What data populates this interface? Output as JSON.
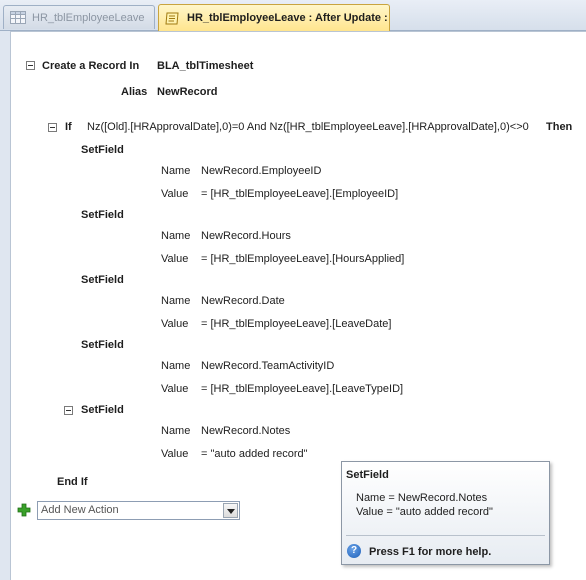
{
  "tabs": [
    {
      "label": "HR_tblEmployeeLeave",
      "active": false,
      "icon": "table-icon"
    },
    {
      "label": "HR_tblEmployeeLeave : After Update :",
      "active": true,
      "icon": "macro-icon"
    }
  ],
  "macro": {
    "create_record": {
      "keyword": "Create a Record In",
      "target": "BLA_tblTimesheet",
      "alias_label": "Alias",
      "alias_value": "NewRecord"
    },
    "if_block": {
      "keyword": "If",
      "condition": "Nz([Old].[HRApprovalDate],0)=0 And Nz([HR_tblEmployeeLeave].[HRApprovalDate],0)<>0",
      "then_keyword": "Then",
      "end_keyword": "End If"
    },
    "setfields": [
      {
        "label": "SetField",
        "name_label": "Name",
        "name": "NewRecord.EmployeeID",
        "value_label": "Value",
        "value": "= [HR_tblEmployeeLeave].[EmployeeID]"
      },
      {
        "label": "SetField",
        "name_label": "Name",
        "name": "NewRecord.Hours",
        "value_label": "Value",
        "value": "= [HR_tblEmployeeLeave].[HoursApplied]"
      },
      {
        "label": "SetField",
        "name_label": "Name",
        "name": "NewRecord.Date",
        "value_label": "Value",
        "value": "= [HR_tblEmployeeLeave].[LeaveDate]"
      },
      {
        "label": "SetField",
        "name_label": "Name",
        "name": "NewRecord.TeamActivityID",
        "value_label": "Value",
        "value": "= [HR_tblEmployeeLeave].[LeaveTypeID]"
      },
      {
        "label": "SetField",
        "name_label": "Name",
        "name": "NewRecord.Notes",
        "value_label": "Value",
        "value": "= \"auto added record\""
      }
    ]
  },
  "add_action": {
    "placeholder": "Add New Action"
  },
  "tooltip": {
    "title": "SetField",
    "line1": "Name = NewRecord.Notes",
    "line2": "Value = \"auto added record\"",
    "help_text": "Press F1 for more help."
  },
  "colors": {
    "active_tab": "#ffe58e",
    "canvas": "#ffffff",
    "chrome": "#dfe6f0",
    "add_icon": "#3aa12a",
    "help_icon": "#1c5fb8"
  }
}
